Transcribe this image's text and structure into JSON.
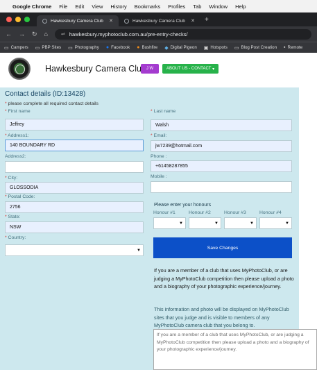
{
  "menubar": {
    "app": "Google Chrome",
    "items": [
      "File",
      "Edit",
      "View",
      "History",
      "Bookmarks",
      "Profiles",
      "Tab",
      "Window",
      "Help"
    ]
  },
  "tabs": [
    {
      "label": "Hawkesbury Camera Club",
      "active": true
    },
    {
      "label": "Hawkesbury Camera Club",
      "active": false
    }
  ],
  "addressbar": {
    "url": "hawkesbury.myphotoclub.com.au/pre-entry-checks/"
  },
  "bookmarks": [
    "Campers",
    "PBP Sites",
    "Photography",
    "Facebook",
    "Bushfire",
    "Digital Pigeon",
    "Hotspots",
    "Blog Post Creation",
    "Remote"
  ],
  "site": {
    "title": "Hawkesbury Camera Club",
    "badge": "J W",
    "about_button": "ABOUT US - CONTACT"
  },
  "form": {
    "title": "Contact details (ID:13428)",
    "hint": "please complete all required contact details",
    "fields": {
      "first_name": {
        "label": "First name",
        "value": "Jeffrey"
      },
      "last_name": {
        "label": "Last name",
        "value": "Walsh"
      },
      "address1": {
        "label": "Address1:",
        "value": "140 BOUNDARY RD"
      },
      "email": {
        "label": "Email:",
        "value": "jw7239@hotmail.com"
      },
      "address2": {
        "label": "Address2:",
        "value": ""
      },
      "phone": {
        "label": "Phone :",
        "value": "+61458287855"
      },
      "mobile": {
        "label": "Mobile :",
        "value": ""
      },
      "city": {
        "label": "City:",
        "value": "GLOSSODIA"
      },
      "postal": {
        "label": "Postal Code:",
        "value": "2756"
      },
      "state": {
        "label": "State:",
        "value": "NSW"
      },
      "country": {
        "label": "Country:",
        "value": ""
      }
    },
    "honours": {
      "title": "Please enter your honours",
      "labels": [
        "Honour #1",
        "Honour #2",
        "Honour #3",
        "Honour #4"
      ]
    },
    "save_label": "Save Changes",
    "info1": "If you are a member of a club that uses MyPhotoClub, or are judging a MyPhotoClub competition then please upload a photo and a biography of your photographic experience/journey.",
    "info2": "This information and photo will be displayed on MyPhotoClub sites that you judge and is visible to members of any MyPhotoClub camera club that you belong to.",
    "bio_placeholder": "If you are a member of a club that uses MyPhotoClub, or are judging a MyPhotoClub competition then please upload a photo and a biography of your photographic experience/journey."
  },
  "colors": {
    "form_bg": "#cde8ee",
    "save_button": "#0c50c8",
    "about_button": "#27b24a",
    "badge": "#a43bcf",
    "required": "#d9302a"
  }
}
